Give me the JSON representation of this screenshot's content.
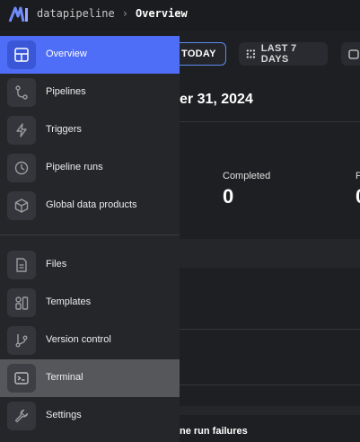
{
  "header": {
    "project": "datapipeline",
    "separator": "›",
    "page": "Overview"
  },
  "toolbar": {
    "today_label": "TODAY",
    "last7_label": "LAST 7 DAYS"
  },
  "main": {
    "date_title": "er 31, 2024",
    "stats": [
      {
        "label": "Completed",
        "value": "0"
      },
      {
        "label": "F",
        "value": "0"
      }
    ],
    "section_heading": "ne run failures"
  },
  "sidebar": {
    "items": [
      {
        "label": "Overview",
        "icon": "overview-grid-icon",
        "state": "active"
      },
      {
        "label": "Pipelines",
        "icon": "pipeline-branch-icon"
      },
      {
        "label": "Triggers",
        "icon": "lightning-icon"
      },
      {
        "label": "Pipeline runs",
        "icon": "clock-icon"
      },
      {
        "label": "Global data products",
        "icon": "cube-icon"
      },
      {
        "label": "Files",
        "icon": "file-icon"
      },
      {
        "label": "Templates",
        "icon": "templates-icon"
      },
      {
        "label": "Version control",
        "icon": "git-branch-icon"
      },
      {
        "label": "Terminal",
        "icon": "terminal-icon",
        "state": "hover"
      },
      {
        "label": "Settings",
        "icon": "wrench-icon"
      }
    ]
  },
  "colors": {
    "accent": "#4f6ef7",
    "sidebar_bg": "#25262a",
    "page_bg": "#1e1f22",
    "hover": "#56575b"
  }
}
